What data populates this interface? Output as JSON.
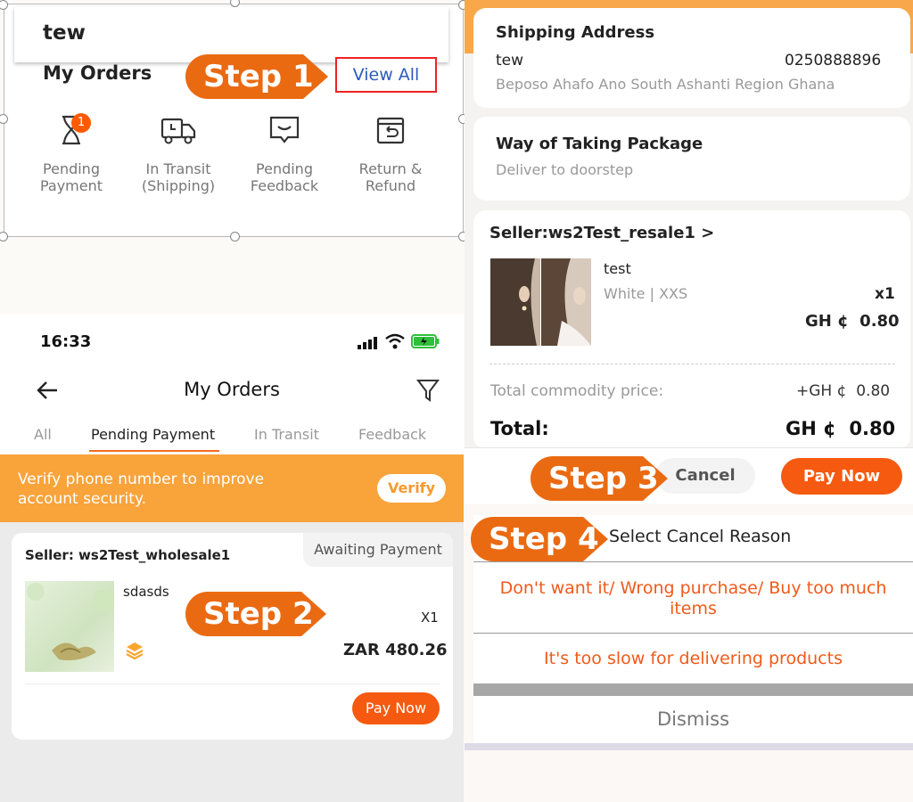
{
  "colors": {
    "accent": "#ea6a12",
    "brand_orange": "#f55a10",
    "banner": "#f9a33b",
    "link_blue": "#2e5bbf",
    "highlight_red": "#e22222"
  },
  "steps": [
    "Step 1",
    "Step 2",
    "Step 3",
    "Step 4"
  ],
  "panel1": {
    "user_name": "tew",
    "title": "My Orders",
    "view_all": "View All",
    "badge_count": "1",
    "categories": [
      {
        "icon": "hourglass-icon",
        "label": "Pending\nPayment"
      },
      {
        "icon": "truck-icon",
        "label": "In Transit\n(Shipping)"
      },
      {
        "icon": "message-icon",
        "label": "Pending\nFeedback"
      },
      {
        "icon": "return-box-icon",
        "label": "Return &\nRefund"
      }
    ]
  },
  "panel2": {
    "status_time": "16:33",
    "title": "My Orders",
    "tabs": [
      "All",
      "Pending Payment",
      "In Transit",
      "Feedback"
    ],
    "banner_text": "Verify phone number to improve account security.",
    "verify_label": "Verify",
    "seller": "Seller: ws2Test_wholesale1",
    "status": "Awaiting Payment",
    "product_name": "sdasds",
    "quantity": "X1",
    "price": "ZAR 480.26",
    "pay_now": "Pay Now"
  },
  "panel3": {
    "shipping_title": "Shipping Address",
    "recipient": "tew",
    "phone": "0250888896",
    "address": "Beposo Ahafo Ano South Ashanti Region Ghana",
    "package_title": "Way of Taking Package",
    "package_method": "Deliver to doorstep",
    "seller": "Seller:ws2Test_resale1",
    "seller_chevron": ">",
    "product_name": "test",
    "variant": "White | XXS",
    "quantity": "x1",
    "unit_price": "GH ¢  0.80",
    "commodity_label": "Total commodity price:",
    "commodity_value": "+GH ¢  0.80",
    "total_label": "Total:",
    "total_value": "GH ¢  0.80",
    "cancel": "Cancel",
    "pay_now": "Pay Now"
  },
  "panel4": {
    "title": "Select Cancel Reason",
    "reasons": [
      "Don't want it/ Wrong purchase/ Buy too much items",
      "It's too slow for delivering products"
    ],
    "dismiss": "Dismiss"
  }
}
